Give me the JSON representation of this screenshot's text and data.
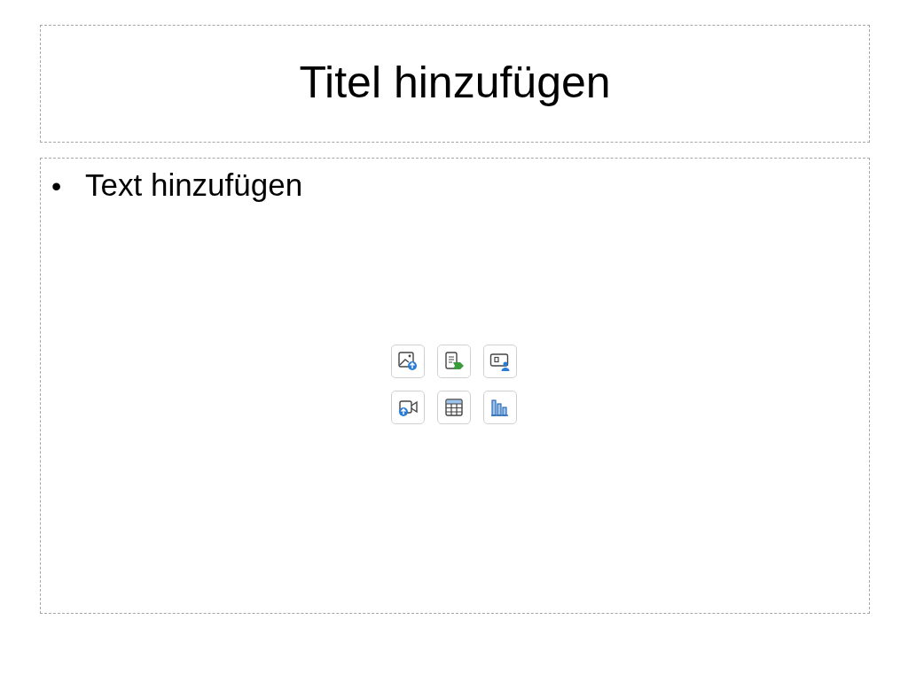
{
  "title_placeholder": {
    "text": "Titel hinzufügen"
  },
  "content_placeholder": {
    "bullet": "•",
    "text": "Text hinzufügen",
    "insert_buttons": [
      {
        "kind": "picture"
      },
      {
        "kind": "document"
      },
      {
        "kind": "presenter"
      },
      {
        "kind": "video"
      },
      {
        "kind": "table"
      },
      {
        "kind": "chart"
      }
    ]
  }
}
